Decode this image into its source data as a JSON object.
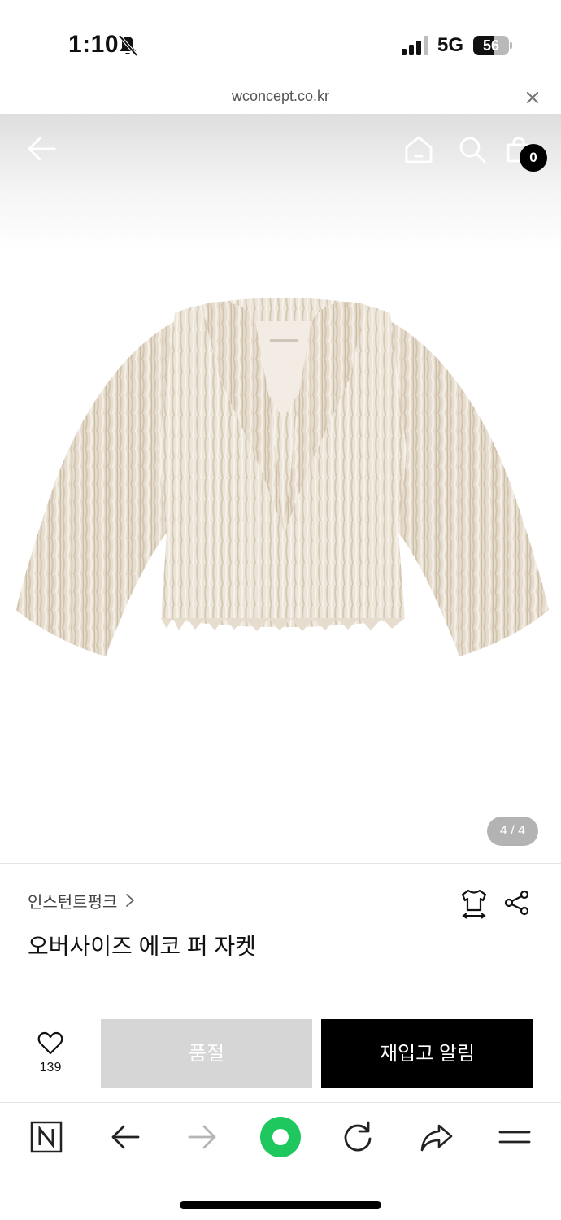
{
  "status_bar": {
    "time": "1:10",
    "network": "5G",
    "battery_level": "56",
    "battery_fraction": 0.56
  },
  "browser": {
    "url": "wconcept.co.kr"
  },
  "header": {
    "cart_count": "0"
  },
  "gallery": {
    "indicator": "4 / 4"
  },
  "product": {
    "brand": "인스턴트펑크",
    "title": "오버사이즈 에코 퍼 자켓"
  },
  "purchase_bar": {
    "wish_count": "139",
    "soldout_label": "품절",
    "restock_label": "재입고 알림"
  },
  "icons": {
    "status": [
      "bell-off-icon",
      "signal-icon",
      "battery-icon"
    ],
    "header": [
      "back-arrow-icon",
      "home-icon",
      "search-icon",
      "shopping-bag-icon"
    ],
    "product": [
      "chevron-right-icon",
      "size-guide-icon",
      "share-icon",
      "heart-icon"
    ],
    "toolbar": [
      "naver-n-icon",
      "back-icon",
      "forward-icon",
      "green-dot-icon",
      "refresh-icon",
      "share-arrow-icon",
      "menu-icon"
    ]
  },
  "colors": {
    "soldout_button": "#d6d6d6",
    "restock_button": "#000000",
    "toolbar_green": "#1ec85e",
    "cart_badge": "#000000"
  }
}
